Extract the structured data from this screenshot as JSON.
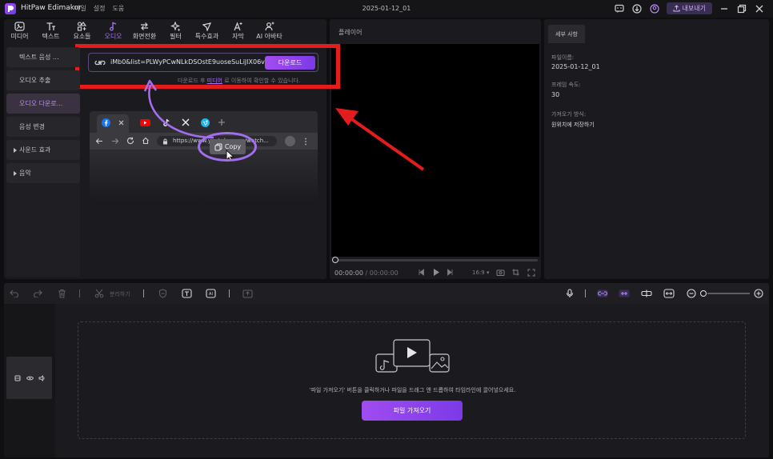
{
  "app": {
    "title": "HitPaw Edimakor",
    "menu": [
      "파일",
      "설정",
      "도움"
    ],
    "document_title": "2025-01-12_01",
    "export_label": "내보내기"
  },
  "toolbar": {
    "tools": [
      {
        "label": "미디어",
        "icon": "media-icon"
      },
      {
        "label": "텍스트",
        "icon": "text-icon"
      },
      {
        "label": "요소들",
        "icon": "elements-icon"
      },
      {
        "label": "오디오",
        "icon": "audio-note-icon",
        "active": true
      },
      {
        "label": "화면전환",
        "icon": "transition-icon"
      },
      {
        "label": "필터",
        "icon": "filter-sparkle-icon"
      },
      {
        "label": "특수효과",
        "icon": "effects-icon"
      },
      {
        "label": "자막",
        "icon": "subtitle-icon"
      },
      {
        "label": "AI 아바타",
        "icon": "ai-avatar-icon"
      }
    ]
  },
  "sidebar": {
    "items": [
      {
        "label": "텍스트 음성 ..."
      },
      {
        "label": "오디오 추출"
      },
      {
        "label": "오디오 다운로..."
      },
      {
        "label": "음성 변경"
      },
      {
        "label": "사운드 효과"
      },
      {
        "label": "음악"
      }
    ]
  },
  "download": {
    "url_value": "iMb0&list=PLWyPCwNLkDSOstE9uoseSuLiJlX06viuO",
    "button_label": "다운로드",
    "hint_prefix": "다운로드 후",
    "hint_link": "미디어",
    "hint_suffix": "로 이동하여 확인할 수 있습니다."
  },
  "browser_illustration": {
    "address": "https://www.youtube.com/watch...",
    "copy_label": "Copy"
  },
  "player": {
    "title": "플레이어",
    "current_time": "00:00:00",
    "total_time": "00:00:00",
    "time_separator": "/",
    "aspect": "16:9"
  },
  "details": {
    "tab_label": "세부 사항",
    "filename_label": "파일이름:",
    "filename_value": "2025-01-12_01",
    "framerate_label": "프레임 속도:",
    "framerate_value": "30",
    "import_method_label": "가져오기 방식:",
    "import_method_value": "원위치에 저장하기"
  },
  "timeline": {
    "split_label": "분리하기",
    "drop_text": "'파일 가져오기' 버튼을 클릭하거나 파일을 드래그 앤 드롭하여 타임라인에 끌어넣으세요.",
    "import_button": "파일 가져오기"
  },
  "colors": {
    "accent": "#a774f7",
    "annotation_red": "#e31c1c",
    "annotation_purple": "#a46ef0"
  }
}
